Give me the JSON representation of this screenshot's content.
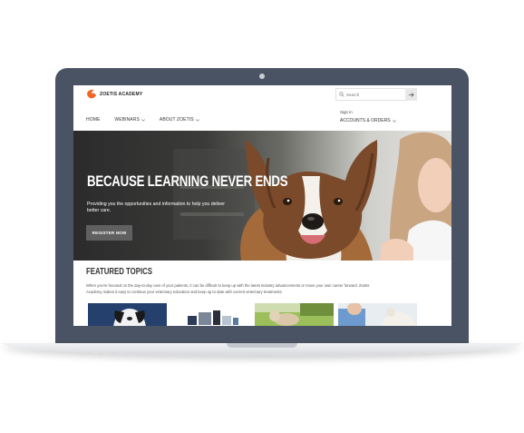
{
  "brand": {
    "name_bold": "ZOETIS",
    "name_rest": " ACADEMY",
    "accent_color": "#f26522"
  },
  "header": {
    "search_placeholder": "Search",
    "search_icon": "search-icon",
    "search_button_icon": "arrow-right-icon",
    "sign_in": "Sign in",
    "accounts_orders": "ACCOUNTS & ORDERS"
  },
  "nav": {
    "items": [
      {
        "label": "HOME",
        "has_dropdown": false
      },
      {
        "label": "WEBINARS",
        "has_dropdown": true
      },
      {
        "label": "ABOUT ZOETIS",
        "has_dropdown": true
      }
    ]
  },
  "hero": {
    "title": "BECAUSE LEARNING NEVER ENDS",
    "subtitle": "Providing you the opportunities and information to help you deliver better care.",
    "cta": "REGISTER NOW"
  },
  "featured": {
    "title": "FEATURED TOPICS",
    "body": "When you're focused on the day-to-day care of your patients, it can be difficult to keep up with the latest industry advancements or move your own career forward. Zoetis Academy makes it easy to continue your veterinary education and keep up to date with current veterinary treatments."
  },
  "colors": {
    "laptop_frame": "#4a5363",
    "cta_bg": "#606060"
  }
}
